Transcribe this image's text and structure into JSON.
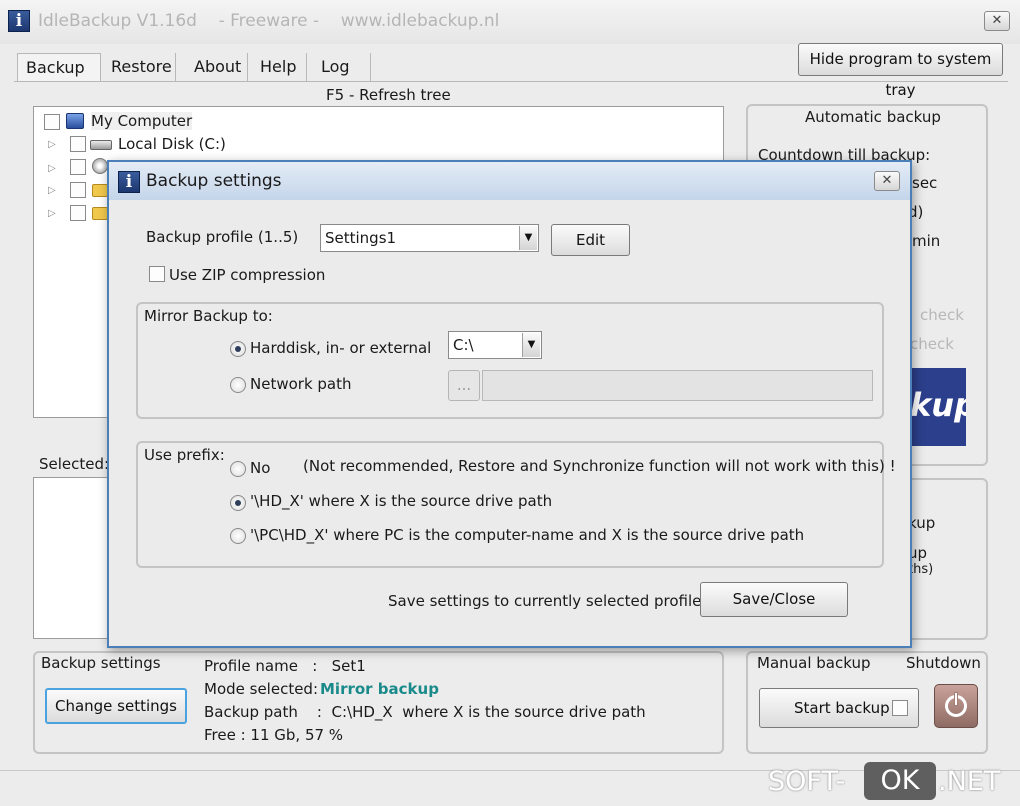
{
  "main_window": {
    "title": "IdleBackup V1.16d    - Freeware -    www.idlebackup.nl",
    "close_glyph": "✕",
    "hide_tray_label": "Hide program to system tray",
    "tabs": [
      {
        "label": "Backup"
      },
      {
        "label": "Restore"
      },
      {
        "label": "About"
      },
      {
        "label": "Help"
      },
      {
        "label": "Log"
      }
    ],
    "refresh_label": "F5 - Refresh tree",
    "tree": {
      "root": "My Computer",
      "items": [
        {
          "label": "Local Disk (C:)"
        }
      ]
    },
    "selected_label": "Selected:",
    "automatic_backup": {
      "title": "Automatic backup",
      "countdown_label": "Countdown till backup:",
      "partial": [
        "sec",
        "d)",
        "min",
        "check",
        "check"
      ],
      "logo_text": "kup"
    },
    "right_panel_partial": [
      "kup",
      "up",
      "ths)"
    ],
    "backup_settings_group": {
      "title": "Backup settings",
      "change_button": "Change settings",
      "profile_name": "Profile name   :   Set1",
      "mode_label": "Mode selected:",
      "mode_value": "Mirror backup",
      "backup_path": "Backup path    :  C:\\HD_X  where X is the source drive path",
      "free": "Free : 11 Gb, 57 %"
    },
    "manual_backup": {
      "title": "Manual backup",
      "shutdown_label": "Shutdown",
      "start_button": "Start backup"
    }
  },
  "dialog": {
    "title": "Backup settings",
    "close_glyph": "✕",
    "profile_label": "Backup profile (1..5)",
    "profile_value": "Settings1",
    "edit_button": "Edit",
    "zip_label": "Use ZIP compression",
    "mirror_group": {
      "title": "Mirror Backup to:",
      "option_harddisk": "Harddisk, in- or external",
      "drive_value": "C:\\",
      "option_network": "Network path",
      "browse_label": "...",
      "selected": "harddisk"
    },
    "prefix_group": {
      "title": "Use prefix:",
      "option_no": "No",
      "option_no_note": "(Not recommended, Restore and Synchronize function will not work with this) !",
      "option_hd": "'\\HD_X' where X is the source drive path",
      "option_pc": "'\\PC\\HD_X' where PC is the computer-name and X is the source drive path",
      "selected": "hd"
    },
    "save_note": "Save settings to currently selected profile",
    "save_button": "Save/Close"
  },
  "watermark": {
    "pre": "SOFT-",
    "ok": "OK",
    "post": ".NET"
  },
  "colors": {
    "mode_value": "#1a8a8a",
    "dialog_border": "#4a7fb8",
    "logo_bg": "#2c3f8c"
  }
}
